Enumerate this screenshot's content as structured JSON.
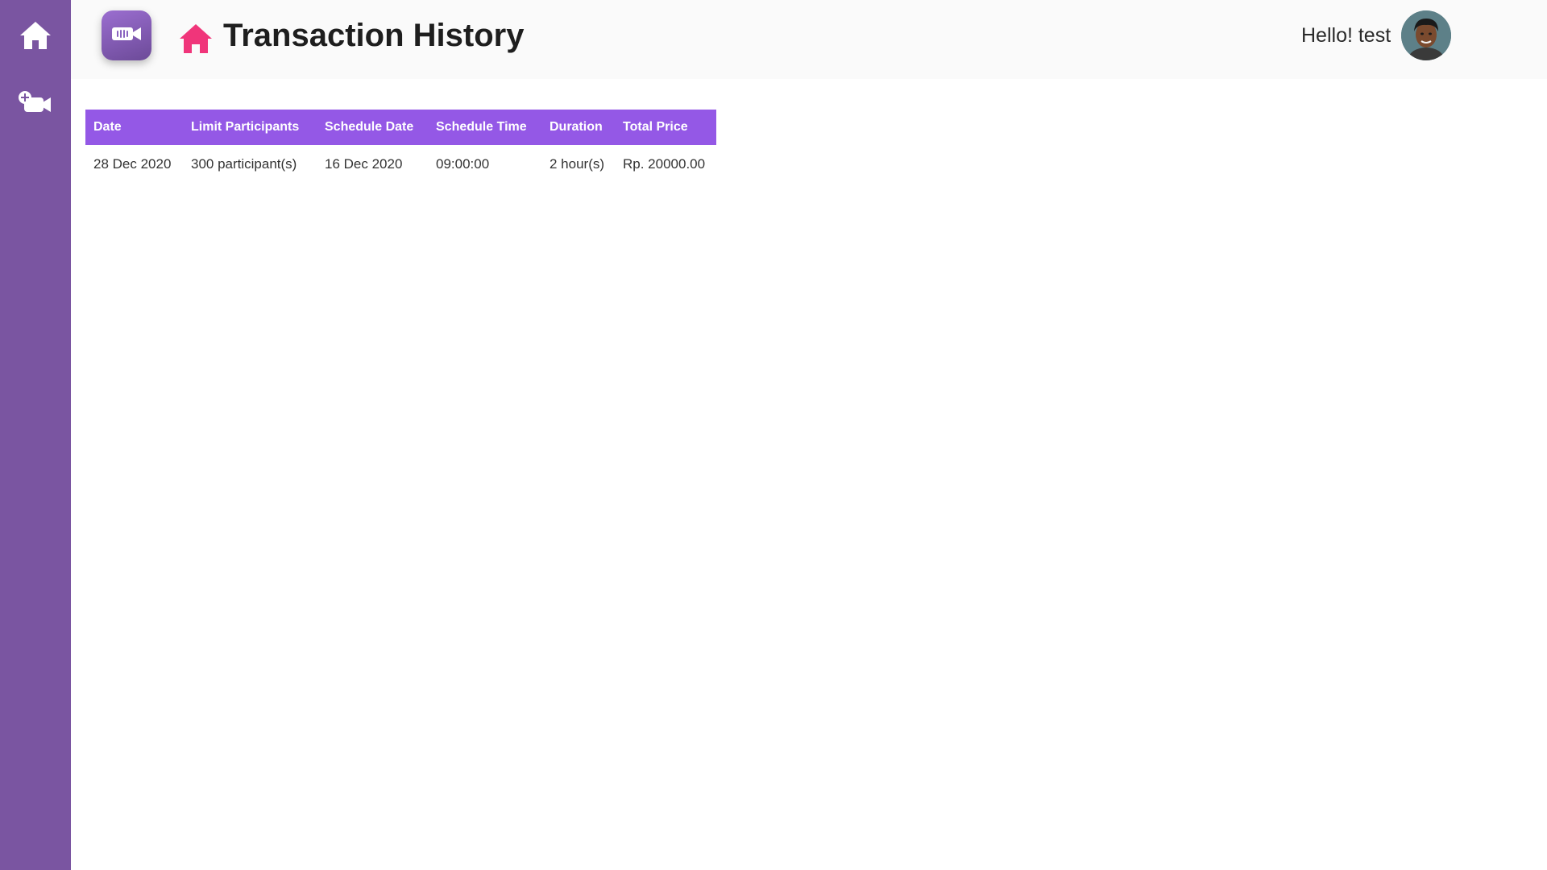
{
  "sidebar": {
    "items": [
      {
        "icon": "home-icon"
      },
      {
        "icon": "add-video-icon"
      }
    ],
    "color": "#7a55a1"
  },
  "header": {
    "logo_icon": "video-camera-icon",
    "title_icon": "home-icon",
    "title": "Transaction History",
    "greeting": "Hello! test",
    "accent": "#f0357a"
  },
  "table": {
    "header_color": "#9458e6",
    "columns": [
      "Date",
      "Limit Participants",
      "Schedule Date",
      "Schedule Time",
      "Duration",
      "Total Price"
    ],
    "rows": [
      [
        "28 Dec 2020",
        "300 participant(s)",
        "16 Dec 2020",
        "09:00:00",
        "2 hour(s)",
        "Rp. 20000.00"
      ]
    ]
  }
}
